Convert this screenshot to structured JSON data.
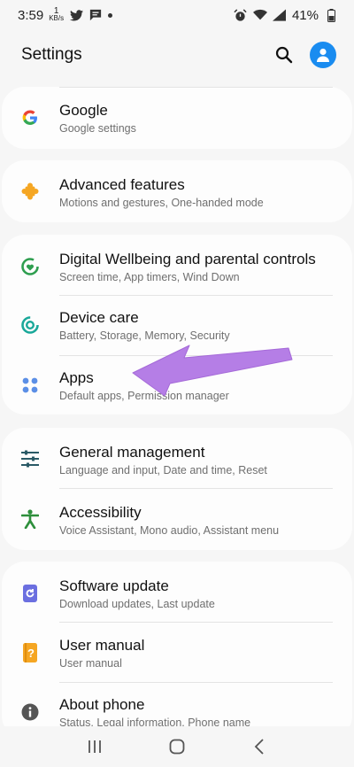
{
  "status_bar": {
    "time": "3:59",
    "speed_value": "1",
    "speed_unit": "KB/s",
    "battery": "41%"
  },
  "header": {
    "title": "Settings"
  },
  "items": {
    "google": {
      "title": "Google",
      "subtitle": "Google settings"
    },
    "advanced": {
      "title": "Advanced features",
      "subtitle": "Motions and gestures, One-handed mode"
    },
    "wellbeing": {
      "title": "Digital Wellbeing and parental controls",
      "subtitle": "Screen time, App timers, Wind Down"
    },
    "device_care": {
      "title": "Device care",
      "subtitle": "Battery, Storage, Memory, Security"
    },
    "apps": {
      "title": "Apps",
      "subtitle": "Default apps, Permission manager"
    },
    "general": {
      "title": "General management",
      "subtitle": "Language and input, Date and time, Reset"
    },
    "accessibility": {
      "title": "Accessibility",
      "subtitle": "Voice Assistant, Mono audio, Assistant menu"
    },
    "software": {
      "title": "Software update",
      "subtitle": "Download updates, Last update"
    },
    "manual": {
      "title": "User manual",
      "subtitle": "User manual"
    },
    "about": {
      "title": "About phone",
      "subtitle": "Status, Legal information, Phone name"
    }
  },
  "icons": {
    "google": "google-g-icon",
    "advanced": "puzzle-icon",
    "wellbeing": "wellbeing-icon",
    "device_care": "device-care-icon",
    "apps": "apps-dots-icon",
    "general": "sliders-icon",
    "accessibility": "accessibility-icon",
    "software": "software-update-icon",
    "manual": "manual-icon",
    "about": "info-icon"
  },
  "colors": {
    "accent_blue": "#1a8cf0",
    "arrow_purple": "#b57ee6",
    "orange": "#f5a623",
    "green": "#2e9e4f",
    "teal": "#1aa89a",
    "indigo": "#6b6fe0"
  }
}
